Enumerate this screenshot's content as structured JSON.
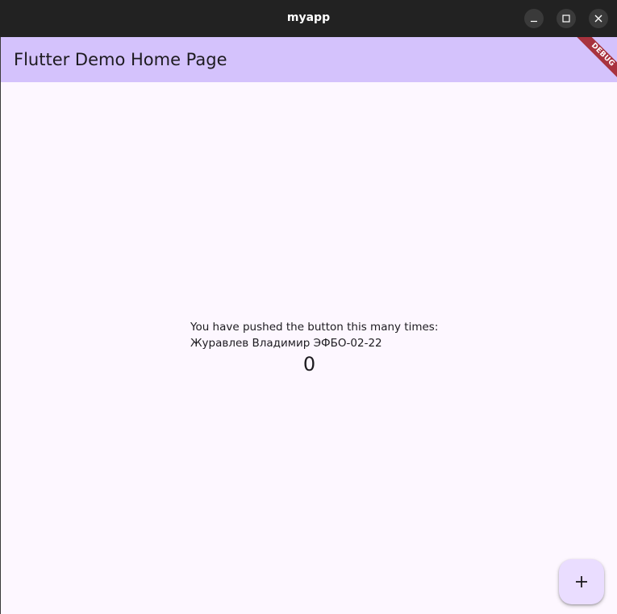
{
  "window": {
    "title": "myapp",
    "controls": {
      "minimize_icon": "minimize-icon",
      "maximize_icon": "maximize-icon",
      "close_icon": "close-icon"
    }
  },
  "appbar": {
    "title": "Flutter Demo Home Page",
    "background": "#d4c2fc"
  },
  "debug_banner": {
    "label": "DEBUG",
    "color": "#a8323e"
  },
  "main": {
    "message": "You have pushed the button this many times:",
    "author": "Журавлев Владимир ЭФБО-02-22",
    "counter": "0"
  },
  "fab": {
    "icon": "add-icon",
    "background": "#eaddff"
  },
  "colors": {
    "titlebar": "#222222",
    "page_background": "#fdf7ff",
    "text": "#1d1b20"
  }
}
